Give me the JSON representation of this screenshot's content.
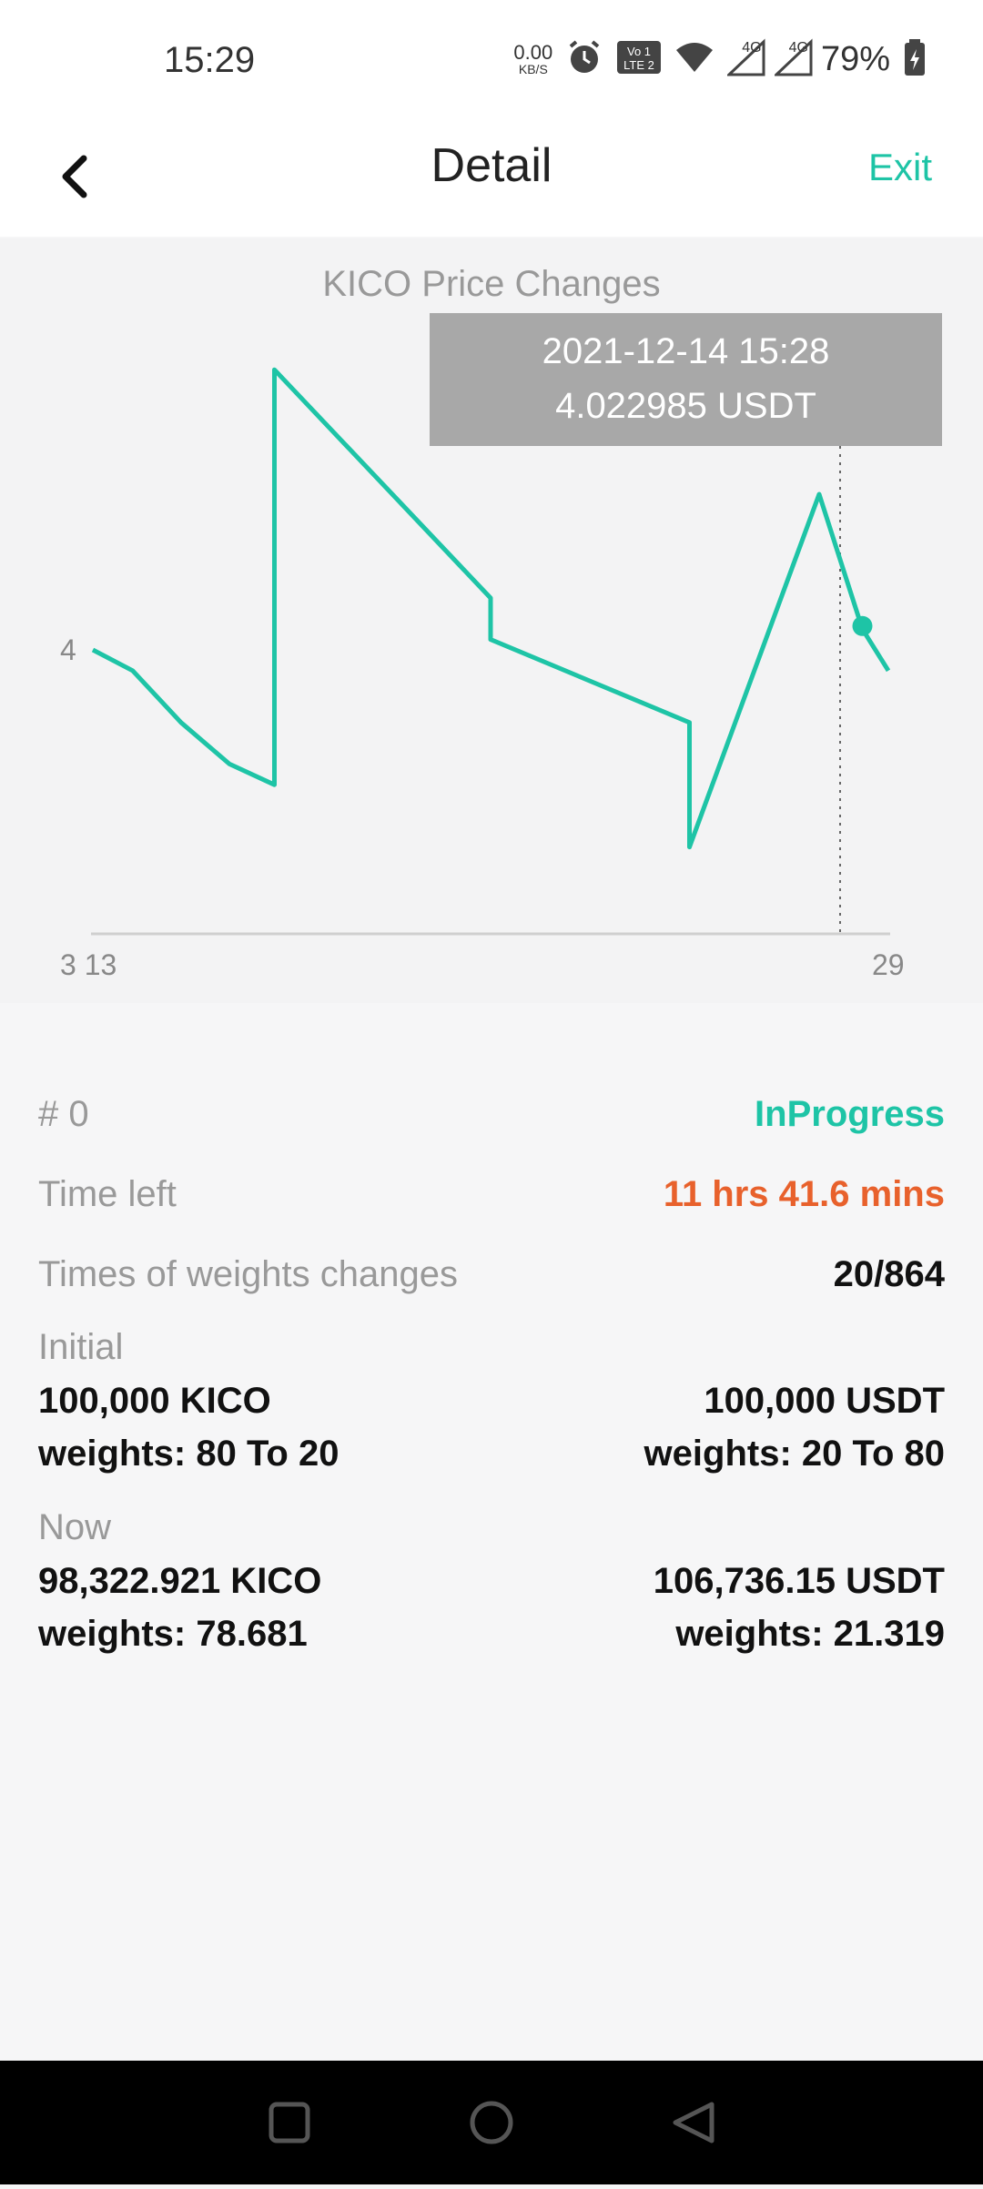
{
  "status_bar": {
    "time": "15:29",
    "net_speed_value": "0.00",
    "net_speed_unit": "KB/S",
    "network_4g_a": "4G",
    "network_4g_b": "4G",
    "battery": "79%"
  },
  "header": {
    "title": "Detail",
    "exit_label": "Exit"
  },
  "chart": {
    "title": "KICO Price Changes",
    "tooltip_time": "2021-12-14 15:28",
    "tooltip_value": "4.022985 USDT",
    "y_tick": "4",
    "x_tick_left": "3 13",
    "x_tick_right": "29"
  },
  "chart_data": {
    "type": "line",
    "title": "KICO Price Changes",
    "series": [
      {
        "values": [
          4.0,
          3.98,
          3.93,
          3.89,
          3.87,
          4.27,
          4.05,
          4.01,
          3.93,
          3.81,
          4.15,
          4.02,
          3.98
        ]
      }
    ],
    "x": [
      3,
      5.3,
      8.1,
      10.9,
      13.5,
      13.5,
      26,
      26,
      37.5,
      37.5,
      45,
      47.5,
      49
    ],
    "yticks": [
      "4"
    ],
    "xticks": [
      "3 13",
      "29"
    ],
    "highlight": {
      "label": "2021-12-14 15:28",
      "value": 4.022985
    },
    "color": "#1ec4a6"
  },
  "details": {
    "index_label": "# 0",
    "status": "InProgress",
    "time_left_label": "Time left",
    "time_left_value": "11 hrs 41.6 mins",
    "weights_changes_label": "Times of weights changes",
    "weights_changes_value": "20/864",
    "initial_label": "Initial",
    "initial_left_amount": "100,000 KICO",
    "initial_left_weights": "weights: 80 To 20",
    "initial_right_amount": "100,000 USDT",
    "initial_right_weights": "weights: 20 To 80",
    "now_label": "Now",
    "now_left_amount": "98,322.921 KICO",
    "now_left_weights": "weights: 78.681",
    "now_right_amount": "106,736.15 USDT",
    "now_right_weights": "weights: 21.319"
  },
  "colors": {
    "accent": "#1ec4a6",
    "warning": "#e8612c"
  }
}
